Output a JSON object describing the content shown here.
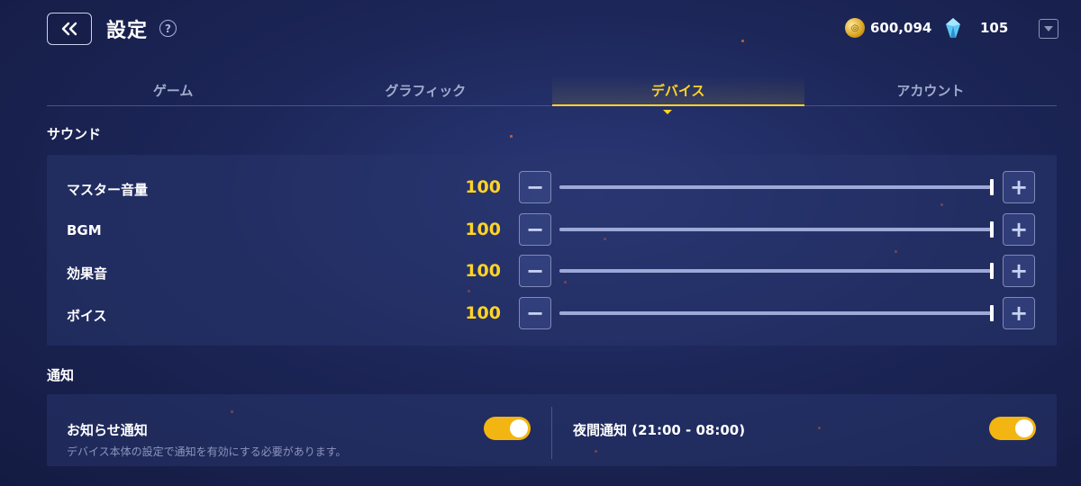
{
  "header": {
    "title": "設定",
    "help_symbol": "?",
    "coins": "600,094",
    "gems": "105",
    "icons": [
      "back-icon",
      "help-icon",
      "coin-icon",
      "gem-icon",
      "dropdown-icon"
    ]
  },
  "tabs": [
    {
      "label": "ゲーム",
      "active": false
    },
    {
      "label": "グラフィック",
      "active": false
    },
    {
      "label": "デバイス",
      "active": true
    },
    {
      "label": "アカウント",
      "active": false
    }
  ],
  "sound": {
    "title": "サウンド",
    "max_value": 100,
    "rows": [
      {
        "label": "マスター音量",
        "value": 100
      },
      {
        "label": "BGM",
        "value": 100
      },
      {
        "label": "効果音",
        "value": 100
      },
      {
        "label": "ボイス",
        "value": 100
      }
    ],
    "minus_symbol": "−",
    "plus_symbol": "+"
  },
  "notifications": {
    "title": "通知",
    "items": [
      {
        "label": "お知らせ通知",
        "sub": "デバイス本体の設定で通知を有効にする必要があります。",
        "on": true
      },
      {
        "label": "夜間通知 (21:00 - 08:00)",
        "sub": "",
        "on": true
      }
    ]
  },
  "colors": {
    "accent": "#ffd426",
    "toggle_on": "#f3b511",
    "background": "#1c2658"
  }
}
